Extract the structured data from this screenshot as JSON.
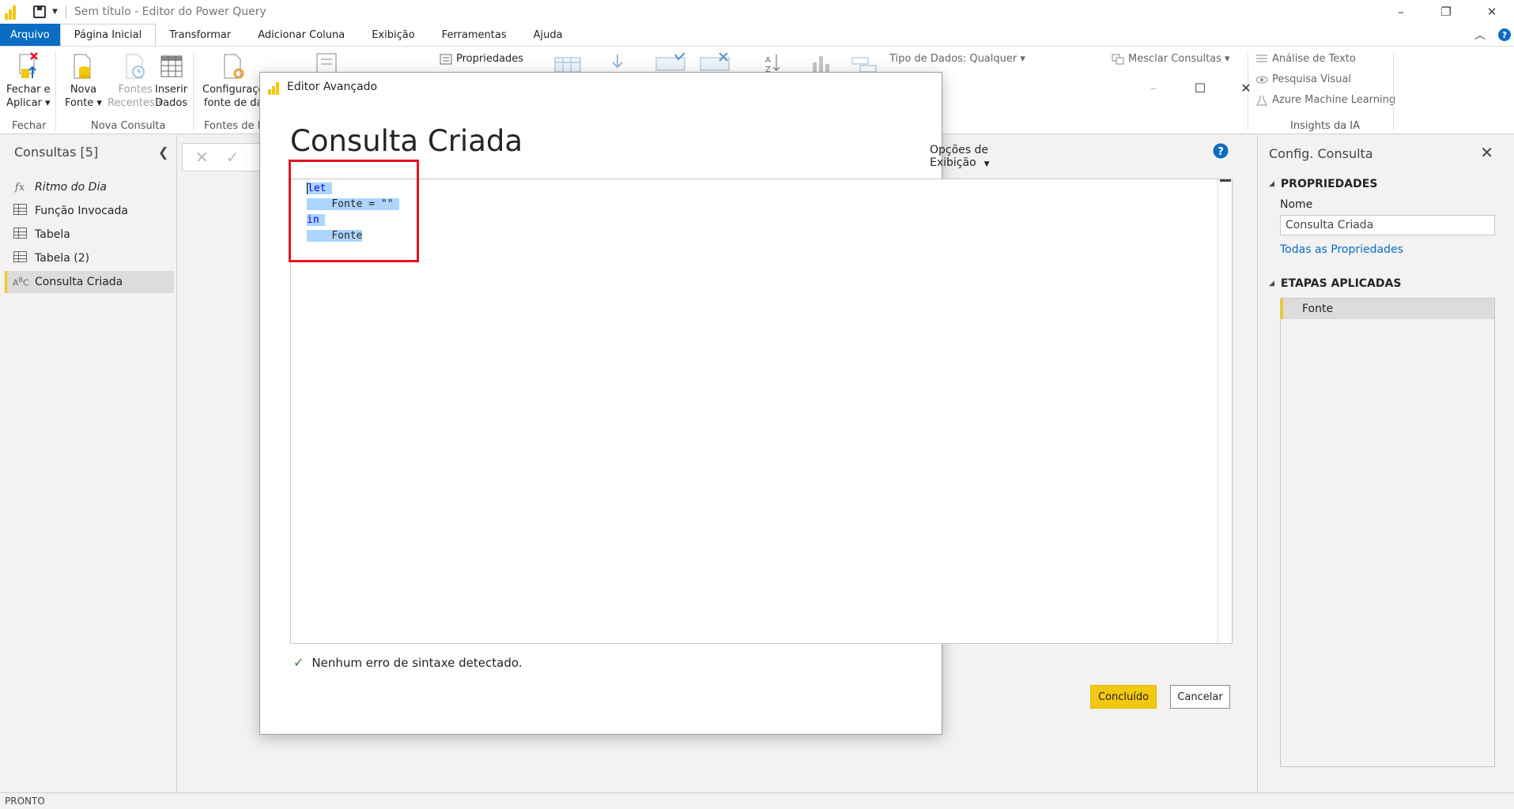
{
  "window": {
    "title": "Sem título - Editor do Power Query",
    "minimize": "–",
    "restore": "❐",
    "close": "✕"
  },
  "ribbon_tabs": [
    {
      "label": "Arquivo"
    },
    {
      "label": "Página Inicial"
    },
    {
      "label": "Transformar"
    },
    {
      "label": "Adicionar Coluna"
    },
    {
      "label": "Exibição"
    },
    {
      "label": "Ferramentas"
    },
    {
      "label": "Ajuda"
    }
  ],
  "ribbon": {
    "close_apply": {
      "line1": "Fechar e",
      "line2": "Aplicar ▾"
    },
    "new_source": {
      "line1": "Nova",
      "line2": "Fonte ▾"
    },
    "recent_sources": {
      "line1": "Fontes",
      "line2": "Recentes ▾"
    },
    "enter_data": {
      "line1": "Inserir",
      "line2": "Dados"
    },
    "source_settings": {
      "line1": "Configuraçõ",
      "line2": "fonte de da"
    },
    "properties": "Propriedades",
    "data_type": "Tipo de Dados: Qualquer ▾",
    "merge_queries": "Mesclar Consultas ▾",
    "text_analytics": "Análise de Texto",
    "vision": "Pesquisa Visual",
    "azure_ml": "Azure Machine Learning",
    "groups": {
      "close": "Fechar",
      "new_query": "Nova Consulta",
      "data_sources": "Fontes de D",
      "ai_insights": "Insights da IA"
    }
  },
  "left_panel": {
    "title": "Consultas [5]",
    "queries": [
      {
        "label": "Ritmo do Dia",
        "icon": "fx-icon"
      },
      {
        "label": "Função Invocada",
        "icon": "table-icon"
      },
      {
        "label": "Tabela",
        "icon": "table-icon"
      },
      {
        "label": "Tabela (2)",
        "icon": "table-icon"
      },
      {
        "label": "Consulta Criada",
        "icon": "abc-icon"
      }
    ]
  },
  "right_panel": {
    "title": "Config. Consulta",
    "properties_header": "PROPRIEDADES",
    "name_label": "Nome",
    "name_value": "Consulta Criada",
    "all_properties": "Todas as Propriedades",
    "applied_steps_header": "ETAPAS APLICADAS",
    "steps": [
      "Fonte"
    ]
  },
  "status": "PRONTO",
  "modal": {
    "title": "Editor Avançado",
    "heading": "Consulta Criada",
    "view_options": "Opções de Exibição",
    "code_lines": [
      {
        "indent": "",
        "text": "let"
      },
      {
        "indent": "    ",
        "text": "Fonte = \"\""
      },
      {
        "indent": "",
        "text": "in"
      },
      {
        "indent": "    ",
        "text": "Fonte"
      }
    ],
    "syntax_status": "Nenhum erro de sintaxe detectado.",
    "done_button": "Concluído",
    "cancel_button": "Cancelar"
  },
  "colors": {
    "accent": "#f2c811",
    "file_tab": "#0a6cc2",
    "highlight_box": "#e81123",
    "selection": "#add6ff"
  }
}
